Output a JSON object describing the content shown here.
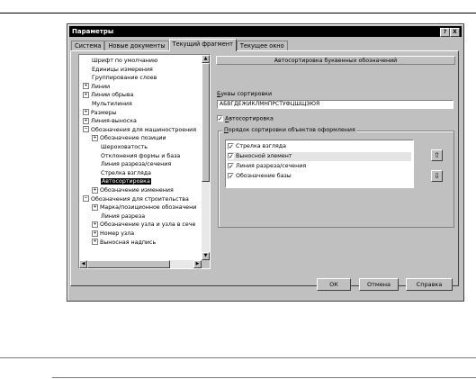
{
  "dialog": {
    "title": "Параметры",
    "help_button": "?",
    "close_button": "X"
  },
  "tabs": [
    {
      "label": "Система",
      "active": false
    },
    {
      "label": "Новые документы",
      "active": false
    },
    {
      "label": "Текущий фрагмент",
      "active": true
    },
    {
      "label": "Текущее окно",
      "active": false
    }
  ],
  "tree": {
    "items": [
      {
        "label": "Шрифт по умолчанию",
        "expander": ""
      },
      {
        "label": "Единицы измерения",
        "expander": ""
      },
      {
        "label": "Группирование слоев",
        "expander": ""
      },
      {
        "label": "Линии",
        "expander": "+"
      },
      {
        "label": "Линии обрыва",
        "expander": "+"
      },
      {
        "label": "Мультилиния",
        "expander": ""
      },
      {
        "label": "Размеры",
        "expander": "+"
      },
      {
        "label": "Линия-выноска",
        "expander": "+"
      },
      {
        "label": "Обозначения для машиностроения",
        "expander": "−"
      },
      {
        "label": "Обозначение позиции",
        "expander": "+"
      },
      {
        "label": "Шероховатость",
        "expander": ""
      },
      {
        "label": "Отклонения формы и база",
        "expander": ""
      },
      {
        "label": "Линия разреза/сечения",
        "expander": ""
      },
      {
        "label": "Стрелка взгляда",
        "expander": ""
      },
      {
        "label": "Автосортировка",
        "expander": ""
      },
      {
        "label": "Обозначение изменения",
        "expander": "+"
      },
      {
        "label": "Обозначения для строительства",
        "expander": "−"
      },
      {
        "label": "Марка/позиционное обозначени",
        "expander": "+"
      },
      {
        "label": "Линия разреза",
        "expander": ""
      },
      {
        "label": "Обозначение узла и узла в сече",
        "expander": "+"
      },
      {
        "label": "Номер узла",
        "expander": "+"
      },
      {
        "label": "Выносная надпись",
        "expander": "+"
      }
    ],
    "selected_index": 14
  },
  "panel": {
    "header": "Автосортировка буквенных обозначений",
    "letters_label_u": "Б",
    "letters_label_rest": "уквы сортировки",
    "letters_value": "АБВГДЕЖИКЛМНПРСТУФЦШЩЭЮЯ",
    "autosort_label_u": "А",
    "autosort_label_rest": "втосортировка",
    "autosort_checked": true,
    "order_group_u": "П",
    "order_group_rest": "орядок сортировки объектов оформления",
    "order_items": [
      {
        "label": "Стрелка взгляда",
        "checked": true
      },
      {
        "label": "Выносной элемент",
        "checked": true
      },
      {
        "label": "Линия разреза/сечения",
        "checked": true
      },
      {
        "label": "Обозначение базы",
        "checked": true
      }
    ],
    "selected_order_index": 1,
    "move_up_icon": "arrow-up-icon",
    "move_down_icon": "arrow-down-icon"
  },
  "buttons": {
    "ok": "ОК",
    "cancel": "Отмена",
    "help": "Справка"
  }
}
